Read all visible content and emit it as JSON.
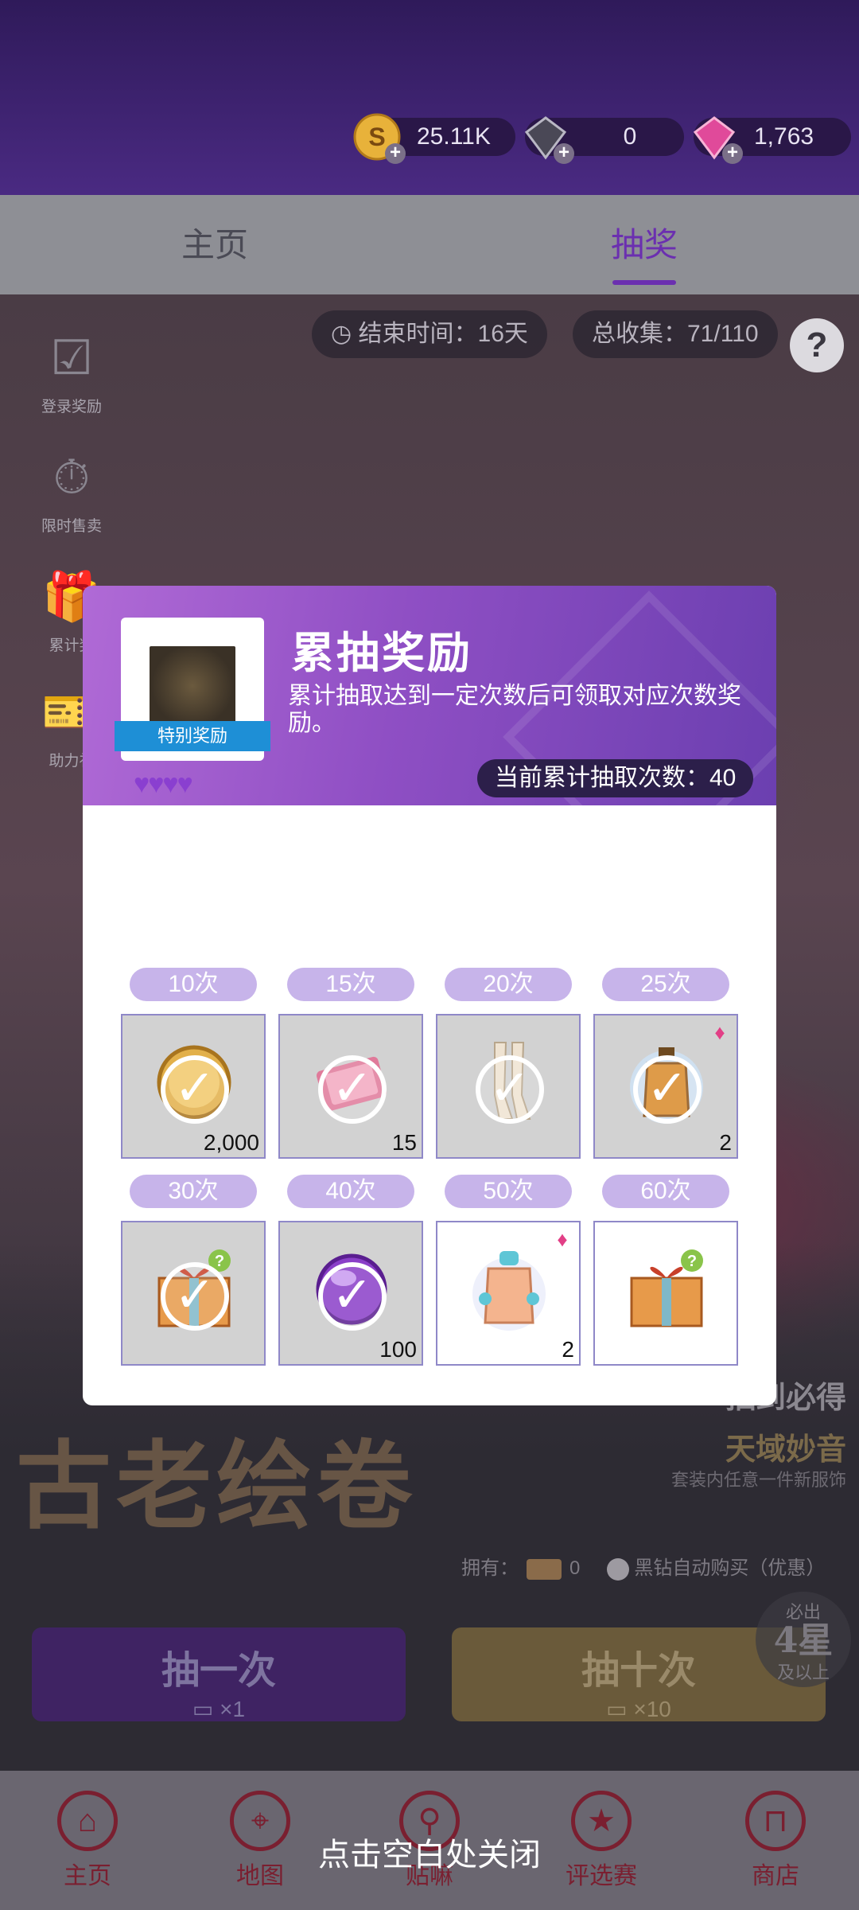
{
  "header": {
    "currencies": [
      {
        "icon": "gold-coin-icon",
        "value": "25.11K"
      },
      {
        "icon": "black-diamond-icon",
        "value": "0"
      },
      {
        "icon": "pink-diamond-icon",
        "value": "1,763"
      }
    ]
  },
  "tabs": [
    {
      "label": "主页",
      "active": false
    },
    {
      "label": "抽奖",
      "active": true
    }
  ],
  "event": {
    "end_time": "结束时间：16天",
    "collection": "总收集：71/110"
  },
  "side_menu": [
    {
      "label": "登录奖励",
      "icon": "calendar-check-icon"
    },
    {
      "label": "限时售卖",
      "icon": "stopwatch-icon"
    },
    {
      "label": "累计奖",
      "icon": "gift-icon"
    },
    {
      "label": "助力礼",
      "icon": "ticket-icon"
    }
  ],
  "banner": {
    "title": "古老绘卷",
    "promo_line1": "抽到必得",
    "promo_line2": "天域妙音",
    "promo_line3": "套装内任意一件新服饰"
  },
  "own": {
    "label": "拥有：",
    "count": "0",
    "auto_buy": "黑钻自动购买（优惠）"
  },
  "draw": {
    "one_label": "抽一次",
    "one_cost": "×1",
    "ten_label": "抽十次",
    "ten_cost": "×10",
    "badge_top": "必出",
    "badge_mid": "4星",
    "badge_bottom": "及以上"
  },
  "bottom_nav": [
    {
      "label": "主页",
      "icon": "home-icon"
    },
    {
      "label": "地图",
      "icon": "map-pin-icon"
    },
    {
      "label": "贴嘛",
      "icon": "search-icon"
    },
    {
      "label": "评选赛",
      "icon": "trophy-icon"
    },
    {
      "label": "商店",
      "icon": "cart-icon"
    }
  ],
  "close_hint": "点击空白处关闭",
  "modal": {
    "title": "累抽奖励",
    "description": "累计抽取达到一定次数后可领取对应次数奖励。",
    "special_label": "特别奖励",
    "special_stars": 4,
    "current_count": "当前累计抽取次数：40",
    "rewards": [
      {
        "tier": "10次",
        "item": "gold-coin",
        "qty": "2,000",
        "claimed": true
      },
      {
        "tier": "15次",
        "item": "pink-ticket",
        "qty": "15",
        "claimed": true
      },
      {
        "tier": "20次",
        "item": "stockings",
        "qty": "",
        "claimed": true
      },
      {
        "tier": "25次",
        "item": "perfume-bottle",
        "qty": "2",
        "claimed": true
      },
      {
        "tier": "30次",
        "item": "mystery-gift-box",
        "qty": "",
        "claimed": true
      },
      {
        "tier": "40次",
        "item": "purple-gem",
        "qty": "100",
        "claimed": true
      },
      {
        "tier": "50次",
        "item": "perfume-bottle-blue",
        "qty": "2",
        "claimed": false
      },
      {
        "tier": "60次",
        "item": "mystery-gift-box",
        "qty": "",
        "claimed": false
      }
    ]
  },
  "colors": {
    "header_purple": "#4a2a82",
    "accent_purple": "#6b2fb0",
    "tier_pill": "#c7b4ea",
    "ribbon_blue": "#1e8fd6"
  }
}
